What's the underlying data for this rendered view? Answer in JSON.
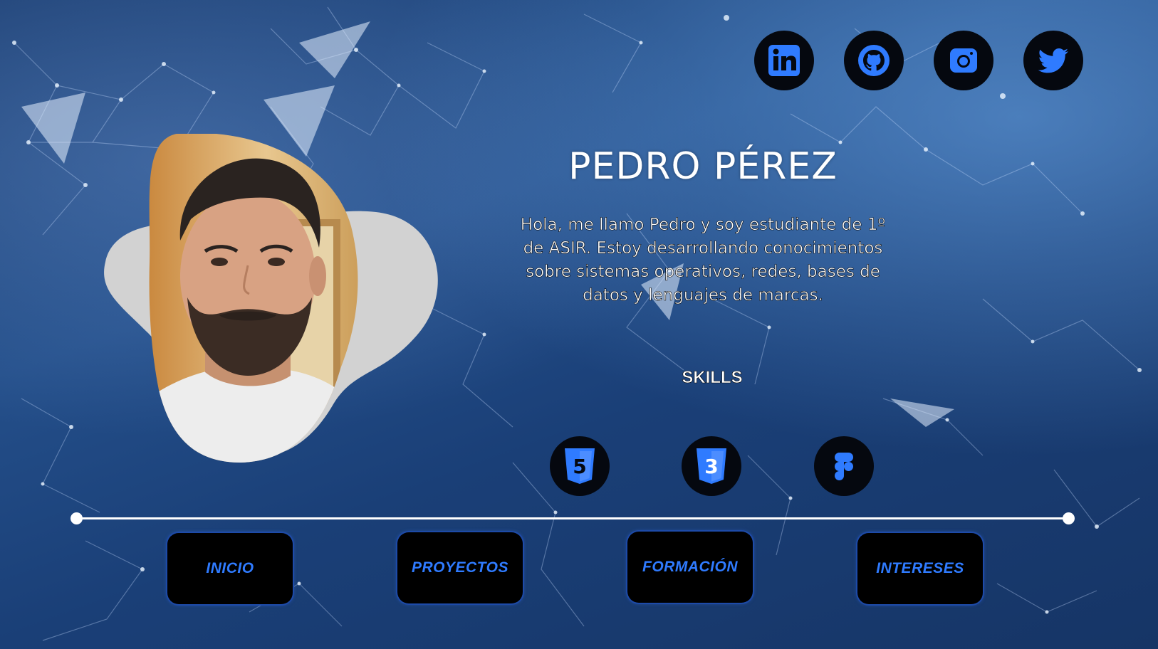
{
  "profile": {
    "name": "PEDRO PÉREZ",
    "bio": "Hola, me llamo Pedro y soy estudiante de 1º de ASIR. Estoy desarrollando conocimientos sobre sistemas operativos, redes, bases de datos y lenguajes de marcas."
  },
  "social": [
    {
      "icon": "linkedin-icon"
    },
    {
      "icon": "github-icon"
    },
    {
      "icon": "instagram-icon"
    },
    {
      "icon": "twitter-icon"
    }
  ],
  "skills": {
    "heading": "SKILLS",
    "items": [
      {
        "icon": "html5-icon",
        "glyph": "5"
      },
      {
        "icon": "css3-icon",
        "glyph": "3"
      },
      {
        "icon": "figma-icon"
      }
    ]
  },
  "nav": {
    "inicio": "INICIO",
    "proyectos": "PROYECTOS",
    "formacion": "FORMACIÓN",
    "intereses": "INTERESES"
  },
  "colors": {
    "accent_blue": "#2f7bff",
    "icon_bg": "#05080f",
    "background": "#1f4a85"
  }
}
